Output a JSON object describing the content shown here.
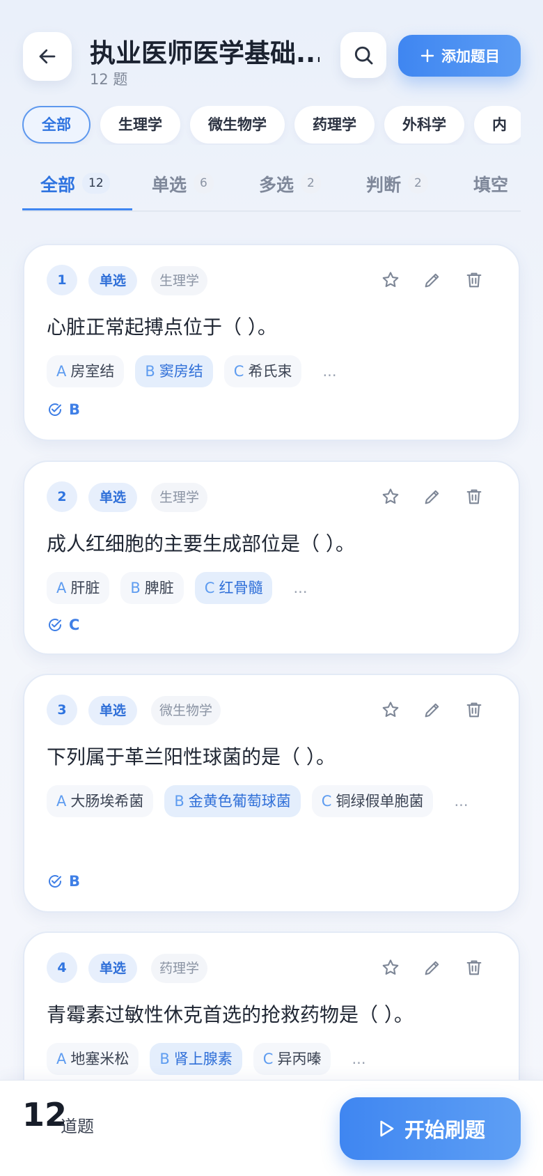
{
  "header": {
    "title": "执业医师医学基础...",
    "subtitle": "12 题",
    "add_label": "添加题目",
    "icons": {
      "back": "arrow-left-icon",
      "search": "search-icon",
      "add": "plus-icon"
    }
  },
  "chips": [
    "全部",
    "生理学",
    "微生物学",
    "药理学",
    "外科学",
    "内"
  ],
  "tabs": [
    {
      "label": "全部",
      "count": "12"
    },
    {
      "label": "单选",
      "count": "6"
    },
    {
      "label": "多选",
      "count": "2"
    },
    {
      "label": "判断",
      "count": "2"
    },
    {
      "label": "填空",
      "count": ""
    }
  ],
  "questions": [
    {
      "num": "1",
      "type": "单选",
      "subject": "生理学",
      "text": "心脏正常起搏点位于（ ）。",
      "options": [
        {
          "letter": "A",
          "text": "房室结"
        },
        {
          "letter": "B",
          "text": "窦房结"
        },
        {
          "letter": "C",
          "text": "希氏束"
        }
      ],
      "more": "...",
      "answer": "B"
    },
    {
      "num": "2",
      "type": "单选",
      "subject": "生理学",
      "text": "成人红细胞的主要生成部位是（ ）。",
      "options": [
        {
          "letter": "A",
          "text": "肝脏"
        },
        {
          "letter": "B",
          "text": "脾脏"
        },
        {
          "letter": "C",
          "text": "红骨髓"
        }
      ],
      "more": "...",
      "answer": "C"
    },
    {
      "num": "3",
      "type": "单选",
      "subject": "微生物学",
      "text": "下列属于革兰阳性球菌的是（ ）。",
      "options": [
        {
          "letter": "A",
          "text": "大肠埃希菌"
        },
        {
          "letter": "B",
          "text": "金黄色葡萄球菌"
        },
        {
          "letter": "C",
          "text": "铜绿假单胞菌"
        }
      ],
      "more": "...",
      "answer": "B"
    },
    {
      "num": "4",
      "type": "单选",
      "subject": "药理学",
      "text": "青霉素过敏性休克首选的抢救药物是（ ）。",
      "options": [
        {
          "letter": "A",
          "text": "地塞米松"
        },
        {
          "letter": "B",
          "text": "肾上腺素"
        },
        {
          "letter": "C",
          "text": "异丙嗪"
        }
      ],
      "more": "...",
      "answer": ""
    }
  ],
  "footer": {
    "count": "12",
    "count_unit": "道题",
    "start_label": "开始刷题",
    "icons": {
      "start": "play-icon"
    }
  },
  "colors": {
    "accent": "#3f86f1",
    "accent_light": "#e7effc",
    "text": "#1f2633",
    "muted": "#8a93a3"
  }
}
